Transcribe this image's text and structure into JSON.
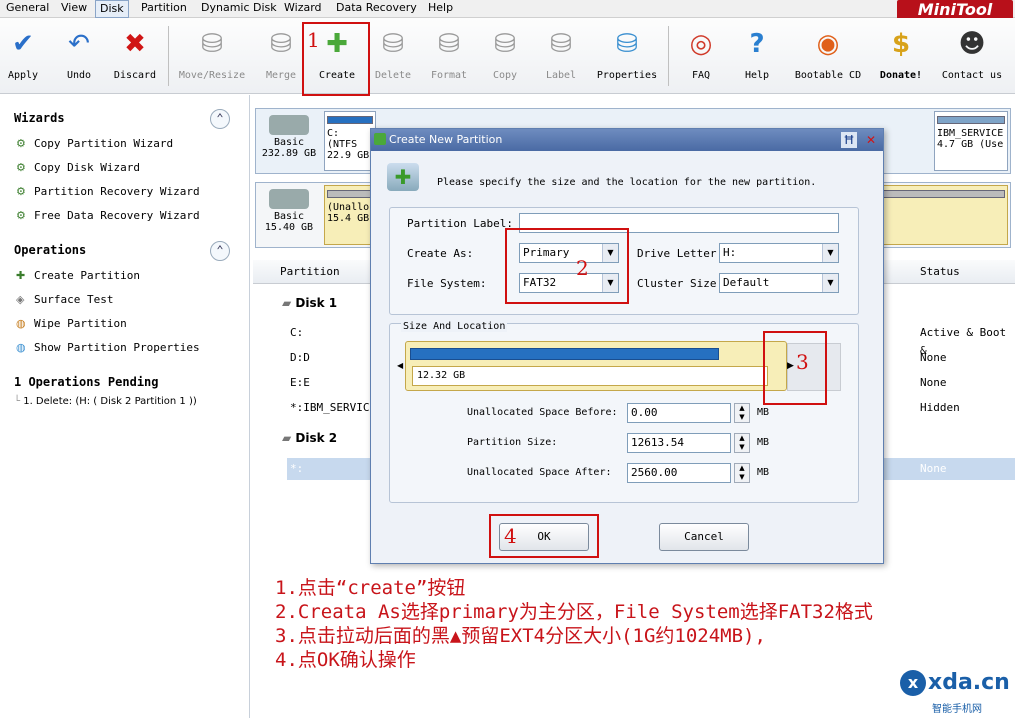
{
  "menubar": {
    "items": [
      "General",
      "View",
      "Disk",
      "Partition",
      "Dynamic Disk",
      "Wizard",
      "Data Recovery",
      "Help"
    ],
    "active": "Disk",
    "logo": "MiniTool"
  },
  "toolbar": {
    "buttons": [
      {
        "label": "Apply",
        "icon": "check-icon",
        "enabled": true
      },
      {
        "label": "Undo",
        "icon": "undo-arrow-icon",
        "enabled": true
      },
      {
        "label": "Discard",
        "icon": "red-x-icon",
        "enabled": true
      },
      {
        "label": "Move/Resize",
        "icon": "disk-move-icon",
        "enabled": false
      },
      {
        "label": "Merge",
        "icon": "disk-merge-icon",
        "enabled": false
      },
      {
        "label": "Create",
        "icon": "disk-create-icon",
        "enabled": true
      },
      {
        "label": "Delete",
        "icon": "disk-delete-icon",
        "enabled": false
      },
      {
        "label": "Format",
        "icon": "disk-format-icon",
        "enabled": false
      },
      {
        "label": "Copy",
        "icon": "disk-copy-icon",
        "enabled": false
      },
      {
        "label": "Label",
        "icon": "disk-label-icon",
        "enabled": false
      },
      {
        "label": "Properties",
        "icon": "disk-properties-icon",
        "enabled": true
      },
      {
        "label": "FAQ",
        "icon": "lifebuoy-icon",
        "enabled": true
      },
      {
        "label": "Help",
        "icon": "question-icon",
        "enabled": true
      },
      {
        "label": "Bootable CD",
        "icon": "fire-cd-icon",
        "enabled": true
      },
      {
        "label": "Donate!",
        "icon": "dollar-icon",
        "enabled": true
      },
      {
        "label": "Contact us",
        "icon": "person-icon",
        "enabled": true
      }
    ]
  },
  "sidebar": {
    "wizards_title": "Wizards",
    "wizards": [
      "Copy Partition Wizard",
      "Copy Disk Wizard",
      "Partition Recovery Wizard",
      "Free Data Recovery Wizard"
    ],
    "operations_title": "Operations",
    "operations": [
      "Create Partition",
      "Surface Test",
      "Wipe Partition",
      "Show Partition Properties"
    ],
    "pending_title": "1 Operations Pending",
    "pending_items": [
      "1. Delete: (H: ( Disk 2 Partition 1 ))"
    ]
  },
  "disk_map": {
    "disk1": {
      "type": "Basic",
      "size": "232.89 GB",
      "part1_name": "C: (NTFS",
      "part1_size": "22.9 GB",
      "last_name": "IBM_SERVICE",
      "last_size": "4.7 GB (Use"
    },
    "disk2": {
      "type": "Basic",
      "size": "15.40 GB",
      "part1_name": "(Unalloc",
      "part1_size": "15.4 GB"
    }
  },
  "list": {
    "headers": {
      "partition": "Partition",
      "status": "Status"
    },
    "disk1_label": "Disk 1",
    "disk1_rows": [
      {
        "name": "C:",
        "status": "Active & Boot &"
      },
      {
        "name": "D:D",
        "status": "None"
      },
      {
        "name": "E:E",
        "status": "None"
      },
      {
        "name": "*:IBM_SERVICE",
        "status": "Hidden"
      }
    ],
    "disk2_label": "Disk 2",
    "disk2_rows": [
      {
        "name": "*:",
        "status": "None"
      }
    ]
  },
  "dialog": {
    "title": "Create New Partition",
    "description": "Please specify the size and the location for the new partition.",
    "partition_label_label": "Partition Label:",
    "partition_label_value": "",
    "create_as_label": "Create As:",
    "create_as_value": "Primary",
    "drive_letter_label": "Drive Letter:",
    "drive_letter_value": "H:",
    "file_system_label": "File System:",
    "file_system_value": "FAT32",
    "cluster_size_label": "Cluster Size:",
    "cluster_size_value": "Default",
    "size_location_title": "Size And Location",
    "bar_size_label": "12.32 GB",
    "bar_fill_fraction": 0.83,
    "unalloc_before_label": "Unallocated Space Before:",
    "unalloc_before_value": "0.00",
    "partition_size_label": "Partition Size:",
    "partition_size_value": "12613.54",
    "unalloc_after_label": "Unallocated Space After:",
    "unalloc_after_value": "2560.00",
    "unit": "MB",
    "ok_label": "OK",
    "cancel_label": "Cancel"
  },
  "annotations": {
    "step_numbers": [
      "1",
      "2",
      "3",
      "4"
    ],
    "instructions": [
      "1.点击“create”按钮",
      "2.Creata As选择primary为主分区，File System选择FAT32格式",
      "3.点击拉动后面的黑▲预留EXT4分区大小(1G约1024MB),",
      "4.点OK确认操作"
    ],
    "color": "#d01010"
  },
  "watermark": {
    "text": "xda.cn",
    "subtitle": "智能手机网"
  }
}
